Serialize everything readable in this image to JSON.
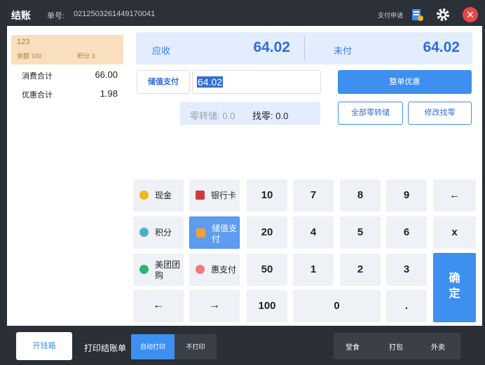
{
  "header": {
    "title": "结账",
    "order_label": "单号:",
    "order_no": "0212503261449170041",
    "pay_apply": "支付申请",
    "close_glyph": "✕"
  },
  "member": {
    "name": "123",
    "balance": "余额 100",
    "points": "积分 3"
  },
  "summary": {
    "consume_label": "消费合计",
    "consume_value": "66.00",
    "discount_label": "优惠合计",
    "discount_value": "1.98"
  },
  "amounts": {
    "receivable_label": "应收",
    "receivable_value": "64.02",
    "unpaid_label": "未付",
    "unpaid_value": "64.02"
  },
  "payment": {
    "method_label": "储值支付",
    "input_value": "64.02",
    "whole_discount": "整单优惠",
    "zero_store": "零转储: 0.0",
    "change": "找零: 0.0",
    "all_zero_store": "全部零转储",
    "modify_change": "修改找零"
  },
  "methods": [
    {
      "label": "现金",
      "icon": "cash-icon",
      "color": "#f2b81c"
    },
    {
      "label": "银行卡",
      "icon": "unionpay-icon",
      "color": "#d23b3b"
    },
    {
      "label": "积分",
      "icon": "points-icon",
      "color": "#4ab0c9"
    },
    {
      "label": "储值支付",
      "icon": "stored-value-icon",
      "color": "#f0a13c"
    },
    {
      "label": "美团团购",
      "icon": "meituan-icon",
      "color": "#2bb573"
    },
    {
      "label": "惠支付",
      "icon": "hui-pay-icon",
      "color": "#f07a7a"
    }
  ],
  "arrows": {
    "left": "←",
    "right": "→"
  },
  "keypad": {
    "k10": "10",
    "k7": "7",
    "k8": "8",
    "k9": "9",
    "backspace": "←",
    "k20": "20",
    "k4": "4",
    "k5": "5",
    "k6": "6",
    "clear": "x",
    "k50": "50",
    "k1": "1",
    "k2": "2",
    "k3": "3",
    "k100": "100",
    "k0": "0",
    "dot": ".",
    "confirm_1": "确",
    "confirm_2": "定"
  },
  "bottom": {
    "open_drawer": "开钱箱",
    "print_label": "打印结账单",
    "auto_print": "自动打印",
    "no_print": "不打印",
    "dine_in": "堂食",
    "takeaway_pack": "打包",
    "delivery": "外卖"
  }
}
